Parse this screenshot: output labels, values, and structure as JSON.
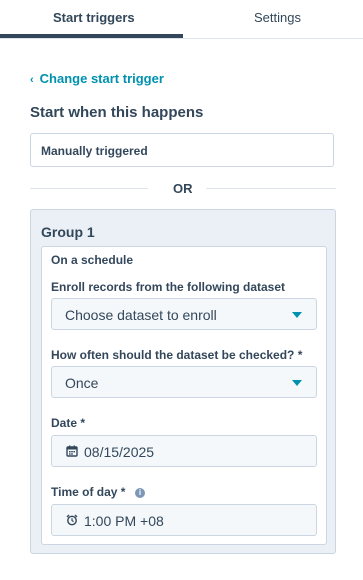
{
  "tabs": {
    "start_triggers": "Start triggers",
    "settings": "Settings"
  },
  "back_link": {
    "label": "Change start trigger",
    "icon": "chevron-left-icon"
  },
  "section_title": "Start when this happens",
  "trigger_value": "Manually triggered",
  "divider_text": "OR",
  "group": {
    "title": "Group 1",
    "card_heading": "On a schedule",
    "dataset_label": "Enroll records from the following dataset",
    "dataset_placeholder": "Choose dataset to enroll",
    "frequency_label": "How often should the dataset be checked? *",
    "frequency_value": "Once",
    "date_label": "Date *",
    "date_value": "08/15/2025",
    "time_label": "Time of day *",
    "time_value": "1:00 PM +08"
  },
  "colors": {
    "accent": "#0091ae",
    "text": "#33475b",
    "group_bg": "#eaf0f6",
    "border": "#cbd6e2"
  }
}
